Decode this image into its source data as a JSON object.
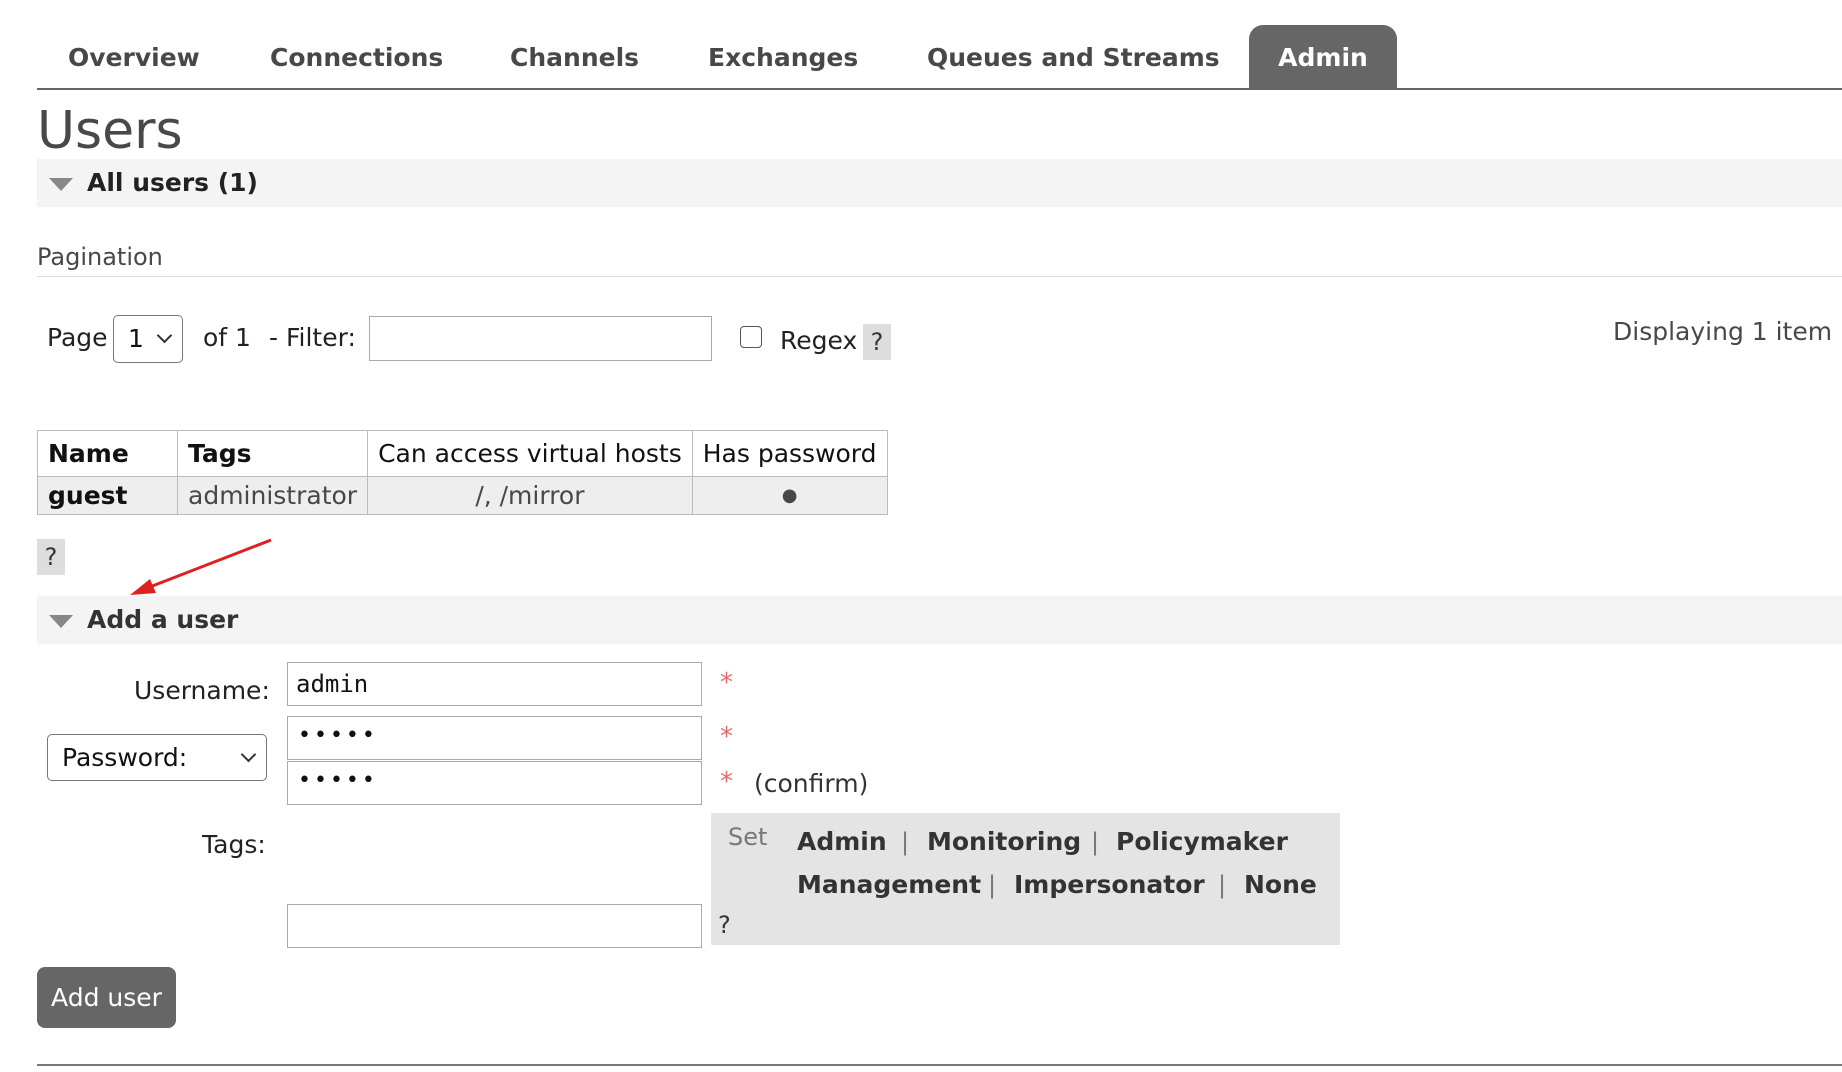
{
  "nav": {
    "tabs": [
      {
        "label": "Overview"
      },
      {
        "label": "Connections"
      },
      {
        "label": "Channels"
      },
      {
        "label": "Exchanges"
      },
      {
        "label": "Queues and Streams"
      },
      {
        "label": "Admin",
        "active": true
      }
    ]
  },
  "page": {
    "title": "Users"
  },
  "all_users": {
    "section_title": "All users (1)",
    "pagination_label": "Pagination",
    "page_label": "Page",
    "page_value": "1",
    "of_label": "of 1",
    "filter_label": "- Filter:",
    "filter_value": "",
    "regex_label": "Regex",
    "help": "?",
    "displaying": "Displaying 1 item ,",
    "table": {
      "headers": [
        "Name",
        "Tags",
        "Can access virtual hosts",
        "Has password"
      ],
      "rows": [
        {
          "name": "guest",
          "tags": "administrator",
          "vhosts": "/, /mirror",
          "has_password": "●"
        }
      ]
    },
    "table_help": "?"
  },
  "add_user": {
    "section_title": "Add a user",
    "username_label": "Username:",
    "username_value": "admin",
    "required_mark": "*",
    "password_select": "Password:",
    "password_mask": "•••••",
    "confirm_mask": "•••••",
    "confirm_label": "(confirm)",
    "tags_label": "Tags:",
    "tags_value": "",
    "set_label": "Set",
    "tag_options": [
      "Admin",
      "Monitoring",
      "Policymaker",
      "Management",
      "Impersonator",
      "None"
    ],
    "separator": "|",
    "tags_help": "?",
    "submit_label": "Add user"
  },
  "colors": {
    "accent_gray": "#666666",
    "required_red": "#e86a6a",
    "annotation_arrow": "#e02020"
  }
}
